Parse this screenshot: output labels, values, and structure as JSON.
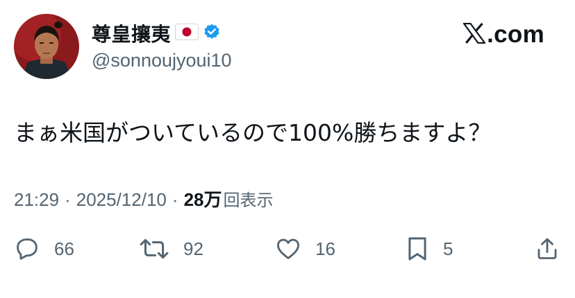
{
  "user": {
    "display_name": "尊皇攘夷",
    "handle": "@sonnoujyoui10",
    "verified": true
  },
  "brand": {
    "domain": ".com"
  },
  "tweet": {
    "text": "まぁ米国がついているので100%勝ちますよ？",
    "time": "21:29",
    "date": "2025/12/10",
    "separator": "·",
    "views_count": "28万",
    "views_label": "回表示"
  },
  "actions": {
    "replies": "66",
    "reposts": "92",
    "likes": "16",
    "bookmarks": "5"
  },
  "colors": {
    "text": "#0f1419",
    "secondary": "#536471",
    "verified_blue": "#1d9bf0",
    "flag_red": "#bc002d"
  }
}
